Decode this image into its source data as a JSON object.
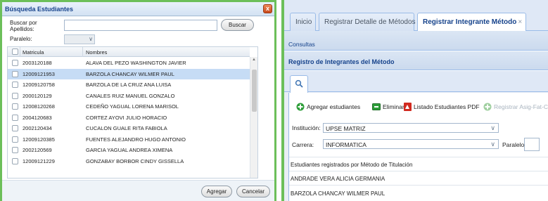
{
  "dialog": {
    "title": "Búsqueda Estudiantes",
    "close_glyph": "x",
    "search_label": "Buscar por Apellidos:",
    "search_value": "",
    "search_button": "Buscar",
    "paralelo_label": "Paralelo:",
    "paralelo_value": "",
    "columns": [
      "Matricula",
      "Nombres"
    ],
    "rows": [
      {
        "matricula": "2003120188",
        "nombre": "ALAVA DEL PEZO WASHINGTON JAVIER",
        "selected": false
      },
      {
        "matricula": "12009121953",
        "nombre": "BARZOLA CHANCAY WILMER PAUL",
        "selected": true
      },
      {
        "matricula": "12009120758",
        "nombre": "BARZOLA DE LA CRUZ ANA LUISA",
        "selected": false
      },
      {
        "matricula": "2000120129",
        "nombre": "CANALES RUIZ MANUEL GONZALO",
        "selected": false
      },
      {
        "matricula": "12008120268",
        "nombre": "CEDEÑO YAGUAL LORENA MARISOL",
        "selected": false
      },
      {
        "matricula": "2004120683",
        "nombre": "CORTEZ AYOVI JULIO HORACIO",
        "selected": false
      },
      {
        "matricula": "2002120434",
        "nombre": "CUCALON GUALE RITA FABIOLA",
        "selected": false
      },
      {
        "matricula": "12009120385",
        "nombre": "FUENTES ALEJANDRO HUGO ANTONIO",
        "selected": false
      },
      {
        "matricula": "2002120569",
        "nombre": "GARCIA YAGUAL ANDREA XIMENA",
        "selected": false
      },
      {
        "matricula": "12009121229",
        "nombre": "GONZABAY BORBOR CINDY GISSELLA",
        "selected": false
      }
    ],
    "add_button": "Agregar",
    "cancel_button": "Cancelar"
  },
  "tabs": [
    {
      "label": "Inicio",
      "closable": false,
      "active": false
    },
    {
      "label": "Registrar Detalle de Métodos",
      "closable": true,
      "active": false
    },
    {
      "label": "Registrar Integrante Método",
      "closable": true,
      "active": true
    }
  ],
  "tab_close_glyph": "×",
  "consultas_label": "Consultas",
  "section_title": "Registro de Integrantes del Método",
  "toolbar": {
    "add_students": "Agregar estudiantes",
    "delete": "Eliminar",
    "pdf_list": "Listado Estudiantes PDF",
    "register": "Registrar Asig-Fat-Ca"
  },
  "form": {
    "institucion_label": "Institución:",
    "institucion_value": "UPSE MATRIZ",
    "carrera_label": "Carrera:",
    "carrera_value": "INFORMATICA",
    "paralelo_label": "Paralelo:",
    "paralelo_value": ""
  },
  "registered_header": "Estudiantes registrados por Método de Titulación",
  "registered": [
    "ANDRADE VERA ALICIA GERMANIA",
    "BARZOLA CHANCAY WILMER PAUL"
  ],
  "colors": {
    "frame_green": "#6cbf5a",
    "header_blue": "#15428b",
    "selected_row": "#c6dcf5",
    "add_icon": "#2e9e3a",
    "pdf_icon": "#d12a1f"
  }
}
